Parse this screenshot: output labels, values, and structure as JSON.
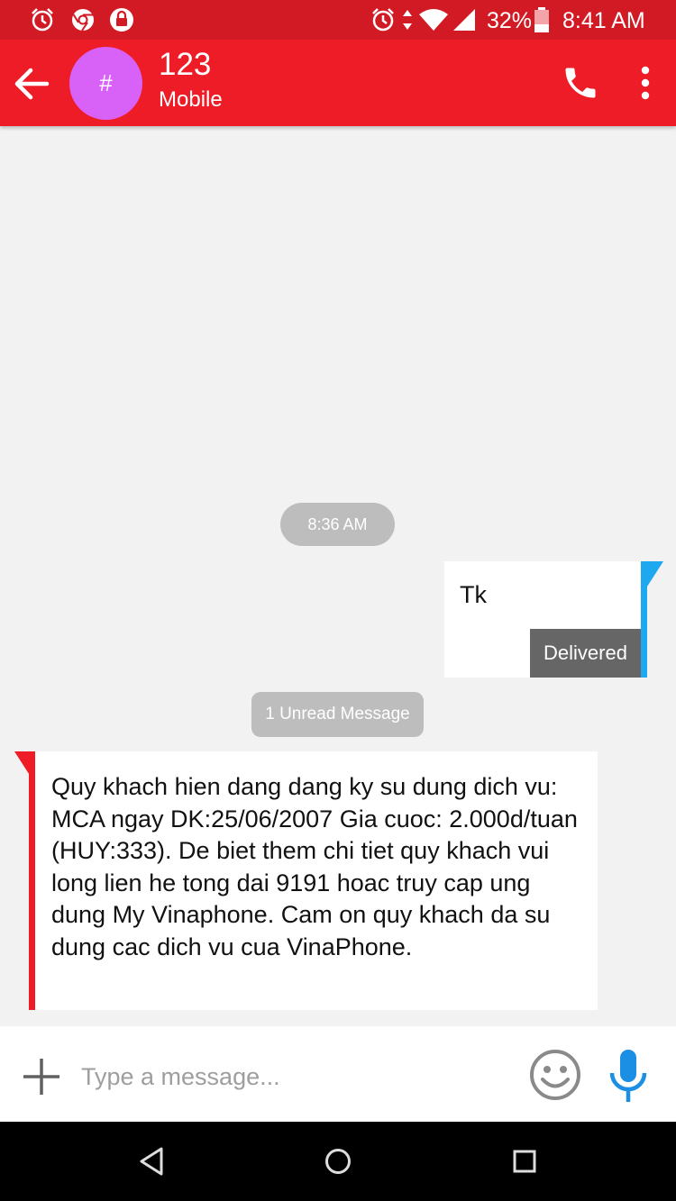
{
  "status_bar": {
    "battery": "32%",
    "time": "8:41 AM",
    "left_icons": [
      "alarm-icon",
      "chrome-icon",
      "lock-icon"
    ],
    "right_icons": [
      "alarm-icon",
      "data-arrows-icon",
      "wifi-icon",
      "signal-icon",
      "battery-icon"
    ],
    "colors": {
      "background": "#d21a24"
    }
  },
  "app_bar": {
    "avatar_symbol": "#",
    "contact_name": "123",
    "contact_type": "Mobile",
    "icons": [
      "back-arrow-icon",
      "phone-icon",
      "more-vert-icon"
    ],
    "colors": {
      "background": "#ee1c27",
      "avatar": "#d862f8"
    }
  },
  "conversation": {
    "timestamp": "8:36 AM",
    "outgoing": {
      "text": "Tk",
      "status": "Delivered",
      "accent_color": "#1ea8f0"
    },
    "unread_label": "1 Unread Message",
    "incoming": {
      "text": "Quy khach hien dang dang ky su dung dich vu: MCA ngay DK:25/06/2007 Gia cuoc: 2.000d/tuan (HUY:333). De biet them chi tiet quy khach vui long lien he tong dai 9191 hoac truy cap ung dung My Vinaphone. Cam on quy khach da su dung cac dich vu cua VinaPhone.",
      "accent_color": "#ee1c27"
    }
  },
  "composer": {
    "placeholder": "Type a message...",
    "value": "",
    "icons": [
      "add-icon",
      "emoji-icon",
      "mic-icon"
    ],
    "mic_color": "#1a8fe3"
  },
  "nav_bar": {
    "icons": [
      "back-triangle-icon",
      "home-circle-icon",
      "recents-square-icon"
    ]
  }
}
